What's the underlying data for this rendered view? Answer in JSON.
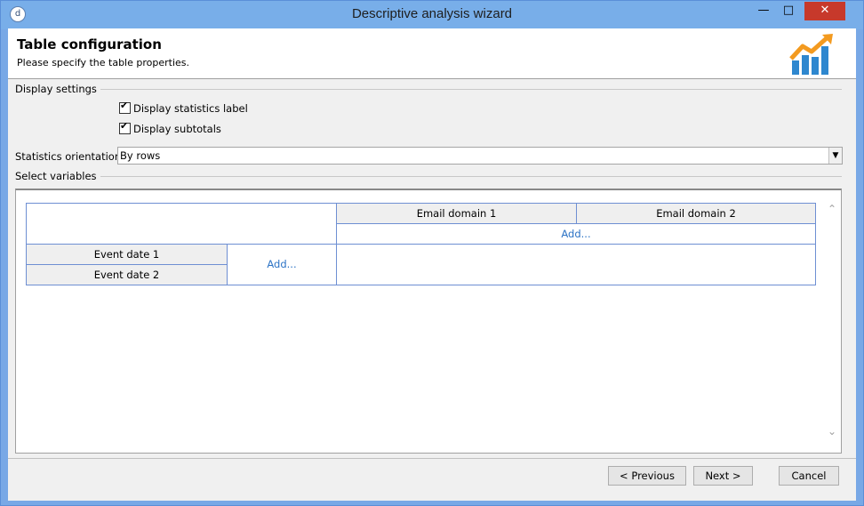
{
  "window": {
    "title": "Descriptive analysis wizard",
    "app_icon": "d",
    "minimize_glyph": "—",
    "maximize_glyph": "□",
    "close_glyph": "✕"
  },
  "header": {
    "title": "Table configuration",
    "subtitle": "Please specify the table properties."
  },
  "display_settings": {
    "label": "Display settings",
    "display_statistics_label": "Display statistics label",
    "display_subtotals": "Display subtotals",
    "orientation_label": "Statistics orientation:",
    "orientation_value": "By rows"
  },
  "variables": {
    "label": "Select variables",
    "columns": [
      "Email domain 1",
      "Email domain 2"
    ],
    "rows": [
      "Event date 1",
      "Event date 2"
    ],
    "add_column": "Add...",
    "add_row": "Add..."
  },
  "buttons": {
    "previous": "< Previous",
    "next": "Next >",
    "cancel": "Cancel"
  },
  "colors": {
    "titlebar": "#78aee9",
    "close": "#c7392b",
    "grid_border": "#6e8fd3",
    "link": "#2c73c5",
    "logo_orange": "#f39a1f",
    "logo_blue": "#2e87cf"
  }
}
